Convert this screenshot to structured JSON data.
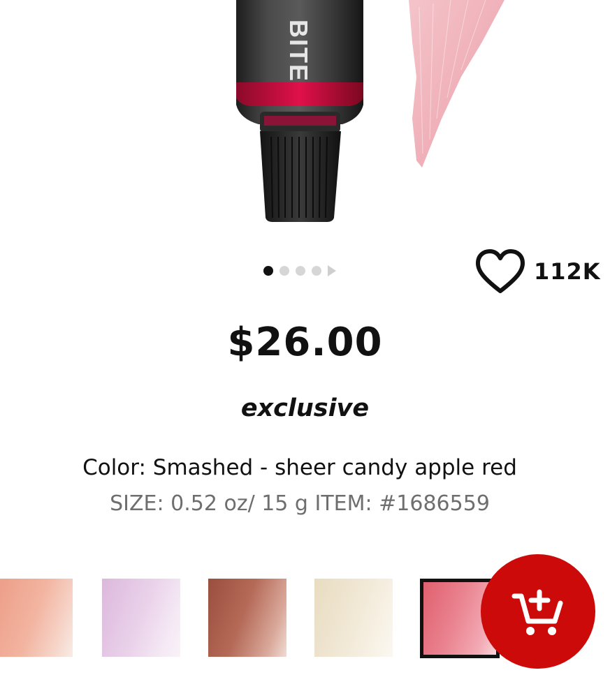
{
  "product": {
    "brand_on_tube": "BITE",
    "price": "$26.00",
    "tag": "exclusive",
    "color_line": "Color: Smashed - sheer candy apple red",
    "size_line": "SIZE: 0.52 oz/ 15 g ITEM: #1686559"
  },
  "gallery": {
    "dots_total": 4,
    "active_index": 0
  },
  "favorite": {
    "count": "112K",
    "icon": "heart-outline-icon"
  },
  "swatches": [
    {
      "name": "peach",
      "color": "#e9a08a",
      "selected": false
    },
    {
      "name": "lilac",
      "color": "#e2c6e2",
      "selected": false
    },
    {
      "name": "bronze",
      "color": "#a86050",
      "selected": false
    },
    {
      "name": "champagne",
      "color": "#efe6d2",
      "selected": false
    },
    {
      "name": "smashed",
      "color": "#e57080",
      "selected": true
    }
  ],
  "cart": {
    "icon": "add-to-cart-icon",
    "color": "#cc0a0a"
  }
}
